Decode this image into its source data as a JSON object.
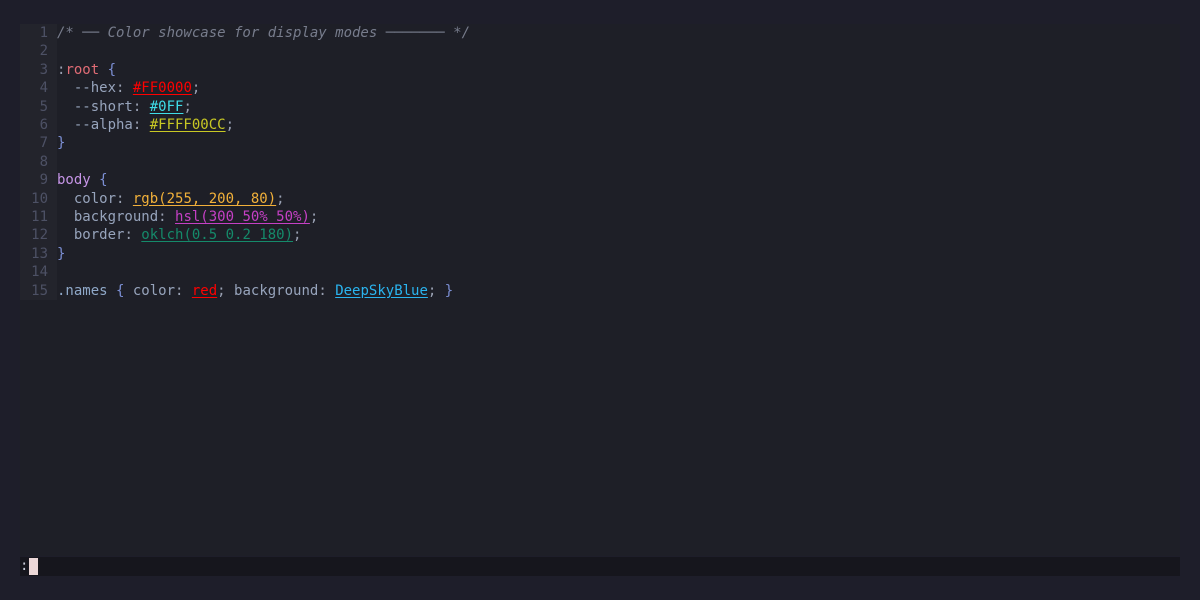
{
  "editor": {
    "colors": {
      "red": "#ff0000",
      "cyan": "#3fdde8",
      "yellow": "#c8c824",
      "orange": "#f2b13a",
      "magenta": "#c540c5",
      "teal": "#158a6a",
      "skyblue": "#2ab4ef"
    },
    "lines": [
      {
        "n": "1",
        "tokens": [
          {
            "t": "/* ── Color showcase for display modes ─────── */",
            "c": "t-comment"
          }
        ]
      },
      {
        "n": "2",
        "tokens": []
      },
      {
        "n": "3",
        "tokens": [
          {
            "t": ":",
            "c": "t-punct"
          },
          {
            "t": "root",
            "c": "t-sel-root"
          },
          {
            "t": " {",
            "c": "t-brace"
          }
        ]
      },
      {
        "n": "4",
        "tokens": [
          {
            "t": "  --hex",
            "c": "t-prop"
          },
          {
            "t": ": ",
            "c": "t-punct"
          },
          {
            "t": "#FF0000",
            "col": "red"
          },
          {
            "t": ";",
            "c": "t-punct"
          }
        ]
      },
      {
        "n": "5",
        "tokens": [
          {
            "t": "  --short",
            "c": "t-prop"
          },
          {
            "t": ": ",
            "c": "t-punct"
          },
          {
            "t": "#0FF",
            "col": "cyan"
          },
          {
            "t": ";",
            "c": "t-punct"
          }
        ]
      },
      {
        "n": "6",
        "tokens": [
          {
            "t": "  --alpha",
            "c": "t-prop"
          },
          {
            "t": ": ",
            "c": "t-punct"
          },
          {
            "t": "#FFFF00CC",
            "col": "yellow"
          },
          {
            "t": ";",
            "c": "t-punct"
          }
        ]
      },
      {
        "n": "7",
        "tokens": [
          {
            "t": "}",
            "c": "t-brace"
          }
        ]
      },
      {
        "n": "8",
        "tokens": []
      },
      {
        "n": "9",
        "tokens": [
          {
            "t": "body",
            "c": "t-sel-body"
          },
          {
            "t": " {",
            "c": "t-brace"
          }
        ]
      },
      {
        "n": "10",
        "tokens": [
          {
            "t": "  color",
            "c": "t-prop"
          },
          {
            "t": ": ",
            "c": "t-punct"
          },
          {
            "t": "rgb(255, 200, 80)",
            "col": "orange"
          },
          {
            "t": ";",
            "c": "t-punct"
          }
        ]
      },
      {
        "n": "11",
        "tokens": [
          {
            "t": "  background",
            "c": "t-prop"
          },
          {
            "t": ": ",
            "c": "t-punct"
          },
          {
            "t": "hsl(300 50% 50%)",
            "col": "magenta"
          },
          {
            "t": ";",
            "c": "t-punct"
          }
        ]
      },
      {
        "n": "12",
        "tokens": [
          {
            "t": "  border",
            "c": "t-prop"
          },
          {
            "t": ": ",
            "c": "t-punct"
          },
          {
            "t": "oklch(0.5 0.2 180)",
            "col": "teal"
          },
          {
            "t": ";",
            "c": "t-punct"
          }
        ]
      },
      {
        "n": "13",
        "tokens": [
          {
            "t": "}",
            "c": "t-brace"
          }
        ]
      },
      {
        "n": "14",
        "tokens": []
      },
      {
        "n": "15",
        "tokens": [
          {
            "t": ".names",
            "c": "t-sel-class"
          },
          {
            "t": " {",
            "c": "t-brace"
          },
          {
            "t": " color",
            "c": "t-prop"
          },
          {
            "t": ": ",
            "c": "t-punct"
          },
          {
            "t": "red",
            "col": "red"
          },
          {
            "t": "; ",
            "c": "t-punct"
          },
          {
            "t": "background",
            "c": "t-prop"
          },
          {
            "t": ": ",
            "c": "t-punct"
          },
          {
            "t": "DeepSkyBlue",
            "col": "skyblue"
          },
          {
            "t": "; ",
            "c": "t-punct"
          },
          {
            "t": "}",
            "c": "t-brace"
          }
        ]
      }
    ]
  },
  "cmdline": {
    "prompt": ":"
  }
}
